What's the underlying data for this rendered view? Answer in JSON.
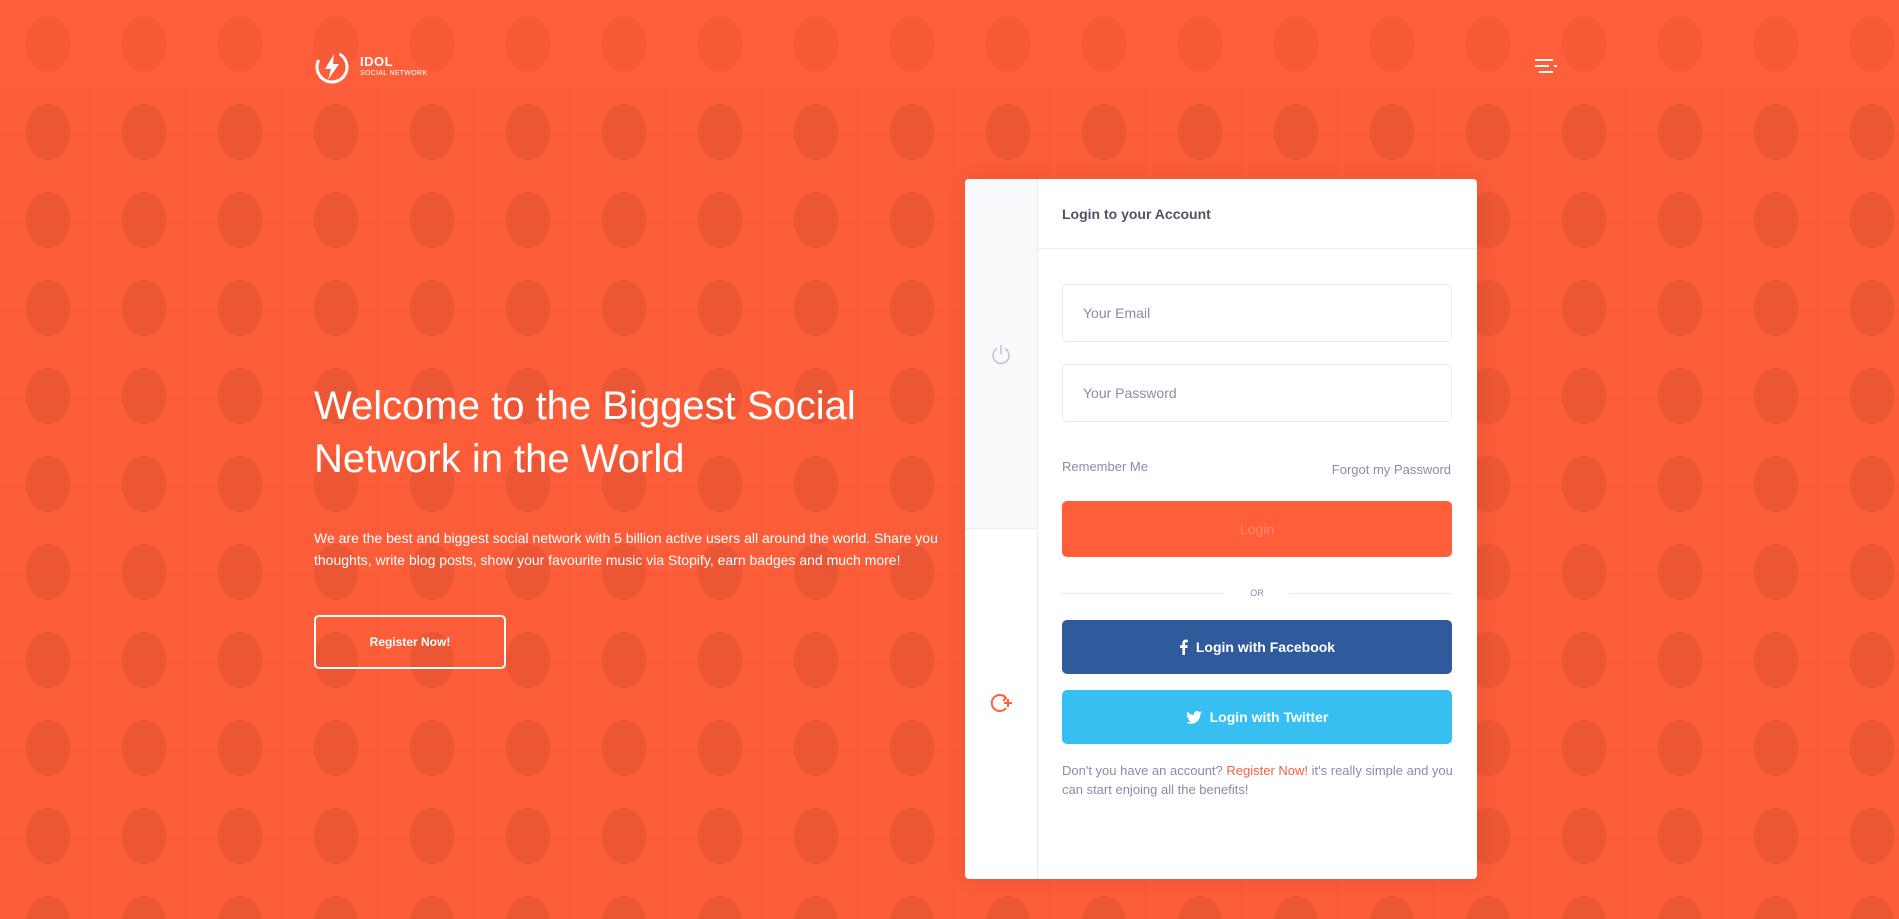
{
  "brand": {
    "title": "IDOL",
    "subtitle": "SOCIAL NETWORK",
    "logo_icon": "lightning-bolt-icon"
  },
  "header": {
    "menu_icon": "menu-icon"
  },
  "hero": {
    "title": "Welcome to the Biggest Social Network in the World",
    "text": "We are the best and biggest social network with 5 billion active users all around the world. Share you thoughts, write blog posts, show your favourite music via Stopify, earn badges and much more!",
    "register_label": "Register Now!"
  },
  "panel": {
    "side_tabs": [
      {
        "icon": "power-icon",
        "active": true
      },
      {
        "icon": "register-icon",
        "active": false
      }
    ],
    "title": "Login to your Account",
    "email_placeholder": "Your Email",
    "password_placeholder": "Your Password",
    "remember_label": "Remember Me",
    "forgot_label": "Forgot my Password",
    "login_label": "Login",
    "or_label": "OR",
    "facebook_label": "Login with Facebook",
    "twitter_label": "Login with Twitter",
    "note_before": "Don't you have an account?",
    "note_link": "Register Now!",
    "note_after": "it's really simple and you can start enjoing all the benefits!"
  },
  "colors": {
    "brand": "#ff5e3a",
    "facebook": "#2f5b9d",
    "twitter": "#38bff1",
    "muted_text": "#888da8",
    "heading_text": "#515365"
  }
}
